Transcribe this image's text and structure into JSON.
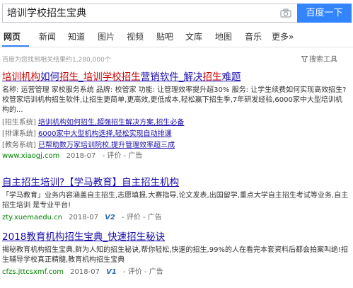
{
  "search": {
    "query": "培训学校招生宝典",
    "button": "百度一下",
    "camera_icon": "camera-icon"
  },
  "tabs": [
    "网页",
    "新闻",
    "知道",
    "图片",
    "视频",
    "贴吧",
    "文库",
    "地图",
    "音乐",
    "更多»"
  ],
  "stats": "百度为您找到相关结果约1,280,000个",
  "tools": {
    "label": "搜索工具",
    "icon": "funnel-icon"
  },
  "results": [
    {
      "title": [
        "培训机构",
        "如何",
        "招生",
        "_",
        "培训学校招生",
        "营销软件_解决",
        "招生",
        "难题"
      ],
      "desc": "名称: 运营管理 家校服务系统 品牌: 校管家 功能: 让管理效率提升超30% 服务: 让学生续费如何实现高效招生?校管家培训机构招生软件,让招生更简单,更高效,更低成本,轻松赢下招生季,7年研发经验,6000家中大型培训机构的...",
      "sitelinks": [
        {
          "tag": "[招生系统]",
          "text": "培训机构如何招生,超强招生解决方案,招生必备"
        },
        {
          "tag": "[排课系统]",
          "text": "6000家中大型机构选择,轻松实现自动排课"
        },
        {
          "tag": "[教务系统]",
          "text": "已帮助数万家培训院校,提升管理效率超三成"
        }
      ],
      "url": "www.xiaogj.com",
      "date": "2018-07",
      "eval": "- 评价 - 广告"
    },
    {
      "title": "自主招生培训?【学马教育】自主招生机构",
      "desc": "「学马教育」业务内容涵盖自主招生,志愿填报,大赛指导,论文发表,出国留学,重点大学自主招生考试等业务,自主招生培训 是专业平台!",
      "url": "zty.xuemaedu.cn",
      "date": "2018-07",
      "badge": "V2",
      "eval": "- 评价 - 广告"
    },
    {
      "title": "2018教育机构招生宝典_快速招生秘诀",
      "desc": "揭秘教育机构招生宝典,鲜为人知的招生秘诀,帮你轻松,快速的招生,99%的人在看完本套资料后都会拍案叫绝!招生辅导学校真正精髓,教育机构招生宝典",
      "url": "cfzs.jttcsxmf.com",
      "date": "2018-07",
      "badge": "V1",
      "eval": "- 评价 - 广告"
    }
  ],
  "colors": {
    "accent": "#3385ff",
    "link": "#1a0dab",
    "highlight": "#cc0000",
    "url": "#008000"
  }
}
